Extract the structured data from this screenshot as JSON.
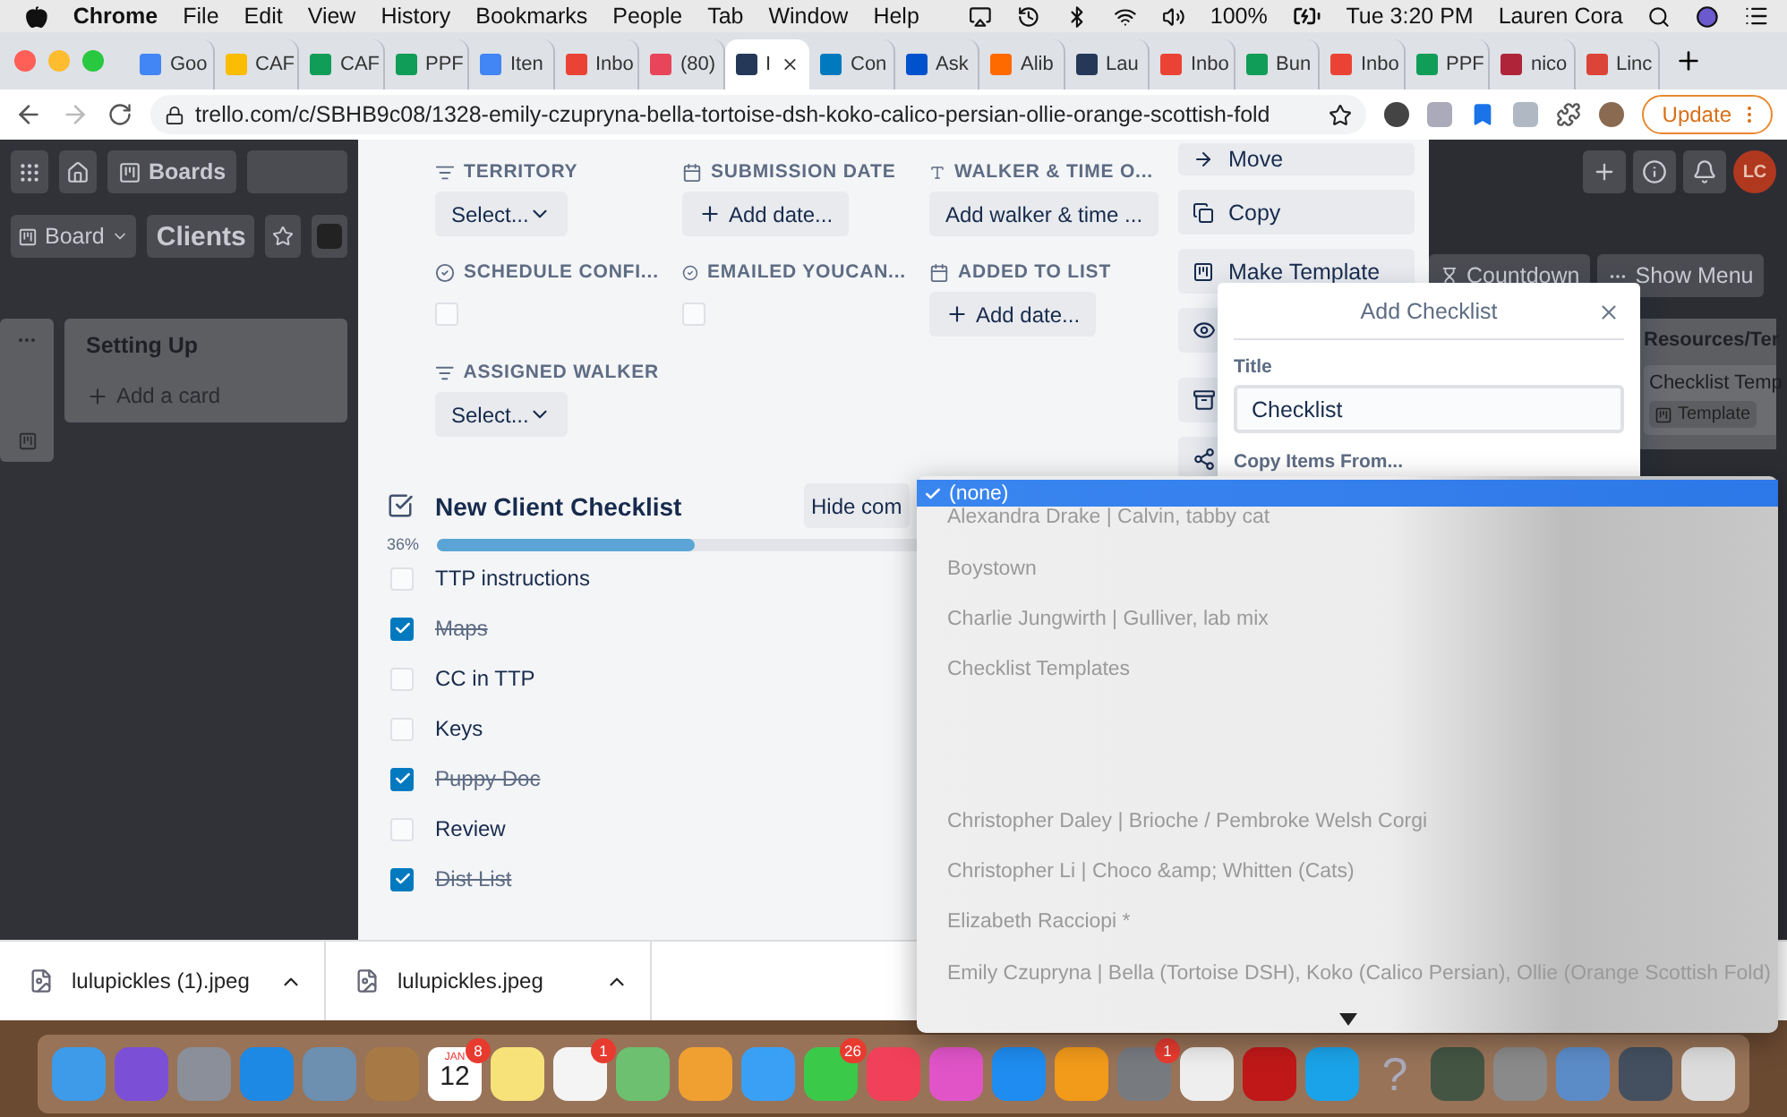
{
  "menu_bar": {
    "app": "Chrome",
    "menus": [
      "File",
      "Edit",
      "View",
      "History",
      "Bookmarks",
      "People",
      "Tab",
      "Window",
      "Help"
    ],
    "battery": "100%",
    "clock": "Tue 3:20 PM",
    "user": "Lauren Cora"
  },
  "tabs": [
    {
      "label": "Goo",
      "color": "#4285f4",
      "selected": false
    },
    {
      "label": "CAF",
      "color": "#fbbc04",
      "selected": false
    },
    {
      "label": "CAF",
      "color": "#0f9d58",
      "selected": false
    },
    {
      "label": "PPF",
      "color": "#0f9d58",
      "selected": false
    },
    {
      "label": "Iten",
      "color": "#4285f4",
      "selected": false
    },
    {
      "label": "Inbo",
      "color": "#ea4335",
      "selected": false
    },
    {
      "label": "(80)",
      "color": "#e8445a",
      "selected": false
    },
    {
      "label": "I",
      "color": "#253858",
      "selected": true
    },
    {
      "label": "Con",
      "color": "#0079bf",
      "selected": false
    },
    {
      "label": "Ask",
      "color": "#0052cc",
      "selected": false
    },
    {
      "label": "Alib",
      "color": "#ff6a00",
      "selected": false
    },
    {
      "label": "Lau",
      "color": "#253858",
      "selected": false
    },
    {
      "label": "Inbo",
      "color": "#ea4335",
      "selected": false
    },
    {
      "label": "Bun",
      "color": "#0f9d58",
      "selected": false
    },
    {
      "label": "Inbo",
      "color": "#ea4335",
      "selected": false
    },
    {
      "label": "PPF",
      "color": "#0f9d58",
      "selected": false
    },
    {
      "label": "nico",
      "color": "#b0243a",
      "selected": false
    },
    {
      "label": "Linc",
      "color": "#db4437",
      "selected": false
    }
  ],
  "address_bar": {
    "url": "trello.com/c/SBHB9c08/1328-emily-czupryna-bella-tortoise-dsh-koko-calico-persian-ollie-orange-scottish-fold",
    "update_button": "Update"
  },
  "board": {
    "nav_button": "Boards",
    "view_button": "Board",
    "board_name": "Clients",
    "list": {
      "title": "Setting Up",
      "add_card": "Add a card"
    },
    "avatar": "LC",
    "header_buttons": [
      "Countdown",
      "Show Menu"
    ],
    "right_list": {
      "title": "Resources/Ter",
      "card": "Checklist Temp",
      "badge": "Template"
    }
  },
  "card": {
    "fields": [
      {
        "label": "TERRITORY",
        "kind": "select",
        "value": "Select..."
      },
      {
        "label": "SUBMISSION DATE",
        "kind": "date",
        "value": "Add date..."
      },
      {
        "label": "WALKER & TIME O...",
        "kind": "text",
        "value": "Add walker & time ..."
      },
      {
        "label": "SCHEDULE CONFI...",
        "kind": "checkbox",
        "checked": false
      },
      {
        "label": "EMAILED YOUCAN...",
        "kind": "checkbox",
        "checked": false
      },
      {
        "label": "ADDED TO LIST",
        "kind": "date",
        "value": "Add date..."
      },
      {
        "label": "ASSIGNED WALKER",
        "kind": "select",
        "value": "Select..."
      }
    ],
    "actions": [
      {
        "kind": "move",
        "label": "Move"
      },
      {
        "kind": "copy",
        "label": "Copy"
      },
      {
        "kind": "template",
        "label": "Make Template"
      },
      {
        "kind": "watch"
      },
      {
        "kind": "archive"
      },
      {
        "kind": "share"
      }
    ],
    "checklist": {
      "title": "New Client Checklist",
      "hide_button": "Hide com",
      "percent": "36%",
      "level": 0.36,
      "items": [
        {
          "label": "TTP instructions",
          "checked": false
        },
        {
          "label": "Maps",
          "checked": true
        },
        {
          "label": "CC in TTP",
          "checked": false
        },
        {
          "label": "Keys",
          "checked": false
        },
        {
          "label": "Puppy Doc",
          "checked": true
        },
        {
          "label": "Review",
          "checked": false
        },
        {
          "label": "Dist List",
          "checked": true
        }
      ]
    }
  },
  "popover": {
    "title": "Add Checklist",
    "title_label": "Title",
    "title_value": "Checklist",
    "copy_label": "Copy Items From..."
  },
  "dropdown": {
    "options": [
      {
        "kind": "option",
        "label": "(none)",
        "selected": true
      },
      {
        "kind": "option",
        "label": "Alexandra Drake | Calvin, tabby cat",
        "selected": false
      },
      {
        "kind": "option",
        "label": "Boystown",
        "selected": false
      },
      {
        "kind": "option",
        "label": "Charlie Jungwirth | Gulliver, lab mix",
        "selected": false
      },
      {
        "kind": "option",
        "label": "Checklist Templates",
        "selected": false
      },
      {
        "kind": "blank"
      },
      {
        "kind": "blank"
      },
      {
        "kind": "option",
        "label": "Christopher Daley | Brioche / Pembroke Welsh Corgi",
        "selected": false
      },
      {
        "kind": "option",
        "label": "Christopher Li | Choco &amp; Whitten (Cats)",
        "selected": false
      },
      {
        "kind": "option",
        "label": "Elizabeth Racciopi *",
        "selected": false
      },
      {
        "kind": "option",
        "label": "Emily Czupryna | Bella (Tortoise DSH), Koko (Calico Persian), Ollie (Orange Scottish Fold)",
        "selected": false
      }
    ]
  },
  "downloads": [
    {
      "name": "lulupickles (1).jpeg"
    },
    {
      "name": "lulupickles.jpeg"
    }
  ],
  "dock": [
    {
      "color": "#3d9be9"
    },
    {
      "color": "#7b4fd6"
    },
    {
      "color": "#8a8f99"
    },
    {
      "color": "#1e88e5"
    },
    {
      "color": "#6d8fb0"
    },
    {
      "color": "#a77a45"
    },
    {
      "kind": "calendar",
      "month": "JAN",
      "day": "12",
      "badge": "8"
    },
    {
      "color": "#f7e27a"
    },
    {
      "color": "#f4f4f4",
      "badge": "1"
    },
    {
      "color": "#6cc070"
    },
    {
      "color": "#f0a030"
    },
    {
      "color": "#3aa0f5"
    },
    {
      "color": "#3bc94a",
      "badge": "26"
    },
    {
      "color": "#f0405a"
    },
    {
      "color": "#e054c8"
    },
    {
      "color": "#1e8cf0"
    },
    {
      "color": "#f29a1a"
    },
    {
      "color": "#777b80",
      "badge": "1"
    },
    {
      "color": "#eeeeee"
    },
    {
      "color": "#c01818"
    },
    {
      "color": "#1aa3e8"
    },
    {
      "kind": "help",
      "glyph": "?"
    },
    {
      "color": "#445544"
    },
    {
      "color": "#8a8a8a"
    },
    {
      "color": "#5c8cc8"
    },
    {
      "color": "#445060"
    },
    {
      "color": "#dcdcdc"
    }
  ]
}
